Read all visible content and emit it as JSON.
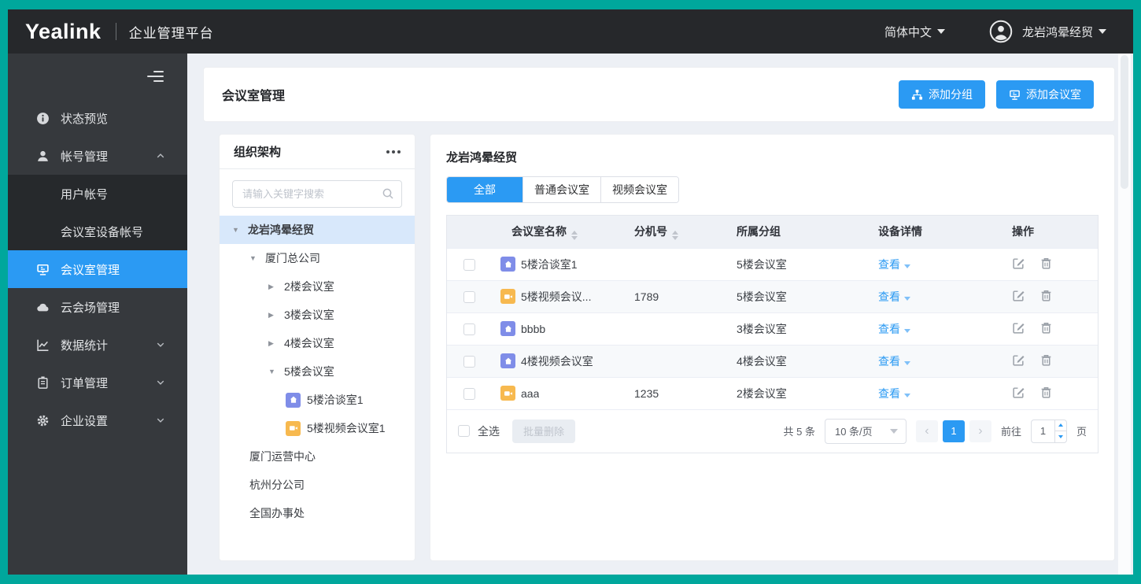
{
  "colors": {
    "accent": "#2B9AF3",
    "frame": "#00A79C",
    "room_normal": "#7F8DE8",
    "room_video": "#F7B94F"
  },
  "topbar": {
    "logo": "Yealink",
    "product": "企业管理平台",
    "language": "简体中文",
    "account": "龙岩鸿晕经贸"
  },
  "sidebar": {
    "items": [
      {
        "label": "状态预览",
        "icon": "info-icon"
      },
      {
        "label": "帐号管理",
        "icon": "user-icon",
        "expanded": true,
        "children": [
          {
            "label": "用户帐号"
          },
          {
            "label": "会议室设备帐号"
          }
        ]
      },
      {
        "label": "会议室管理",
        "icon": "meeting-room-icon",
        "active": true
      },
      {
        "label": "云会场管理",
        "icon": "cloud-icon"
      },
      {
        "label": "数据统计",
        "icon": "stats-icon",
        "collapsed": true
      },
      {
        "label": "订单管理",
        "icon": "order-icon",
        "collapsed": true
      },
      {
        "label": "企业设置",
        "icon": "gear-icon",
        "collapsed": true
      }
    ]
  },
  "page": {
    "title": "会议室管理",
    "add_group_label": "添加分组",
    "add_room_label": "添加会议室"
  },
  "org": {
    "title": "组织架构",
    "search_placeholder": "请输入关键字搜索",
    "tree": [
      {
        "label": "龙岩鸿晕经贸",
        "level": 0,
        "arrow": "expanded",
        "selected": true
      },
      {
        "label": "厦门总公司",
        "level": 1,
        "arrow": "expanded"
      },
      {
        "label": "2楼会议室",
        "level": 2,
        "arrow": "collapsed"
      },
      {
        "label": "3楼会议室",
        "level": 2,
        "arrow": "collapsed"
      },
      {
        "label": "4楼会议室",
        "level": 2,
        "arrow": "collapsed"
      },
      {
        "label": "5楼会议室",
        "level": 2,
        "arrow": "expanded"
      },
      {
        "label": "5楼洽谈室1",
        "level": 3,
        "arrow": "none",
        "icon": "home-icon"
      },
      {
        "label": "5楼视频会议室1",
        "level": 3,
        "arrow": "none",
        "icon": "video-icon"
      },
      {
        "label": "厦门运营中心",
        "level": 1,
        "arrow": "none"
      },
      {
        "label": "杭州分公司",
        "level": 1,
        "arrow": "none"
      },
      {
        "label": "全国办事处",
        "level": 1,
        "arrow": "none"
      }
    ]
  },
  "content": {
    "company": "龙岩鸿晕经贸",
    "tabs": [
      "全部",
      "普通会议室",
      "视频会议室"
    ],
    "active_tab": "全部",
    "table": {
      "columns": {
        "name": "会议室名称",
        "ext": "分机号",
        "group": "所属分组",
        "device": "设备详情",
        "ops": "操作"
      },
      "rows": [
        {
          "name": "5楼洽谈室1",
          "type": "normal",
          "ext": "",
          "group": "5楼会议室",
          "view": "查看"
        },
        {
          "name": "5楼视频会议...",
          "type": "video",
          "ext": "1789",
          "group": "5楼会议室",
          "view": "查看"
        },
        {
          "name": "bbbb",
          "type": "normal",
          "ext": "",
          "group": "3楼会议室",
          "view": "查看"
        },
        {
          "name": "4楼视频会议室",
          "type": "normal",
          "ext": "",
          "group": "4楼会议室",
          "view": "查看"
        },
        {
          "name": "aaa",
          "type": "video",
          "ext": "1235",
          "group": "2楼会议室",
          "view": "查看"
        }
      ]
    },
    "footer": {
      "select_all": "全选",
      "batch_delete": "批量删除",
      "total": "共 5 条",
      "page_size": "10 条/页",
      "prev": "‹",
      "current_page": "1",
      "next": "›",
      "goto_label": "前往",
      "goto_value": "1",
      "page_unit": "页"
    }
  }
}
